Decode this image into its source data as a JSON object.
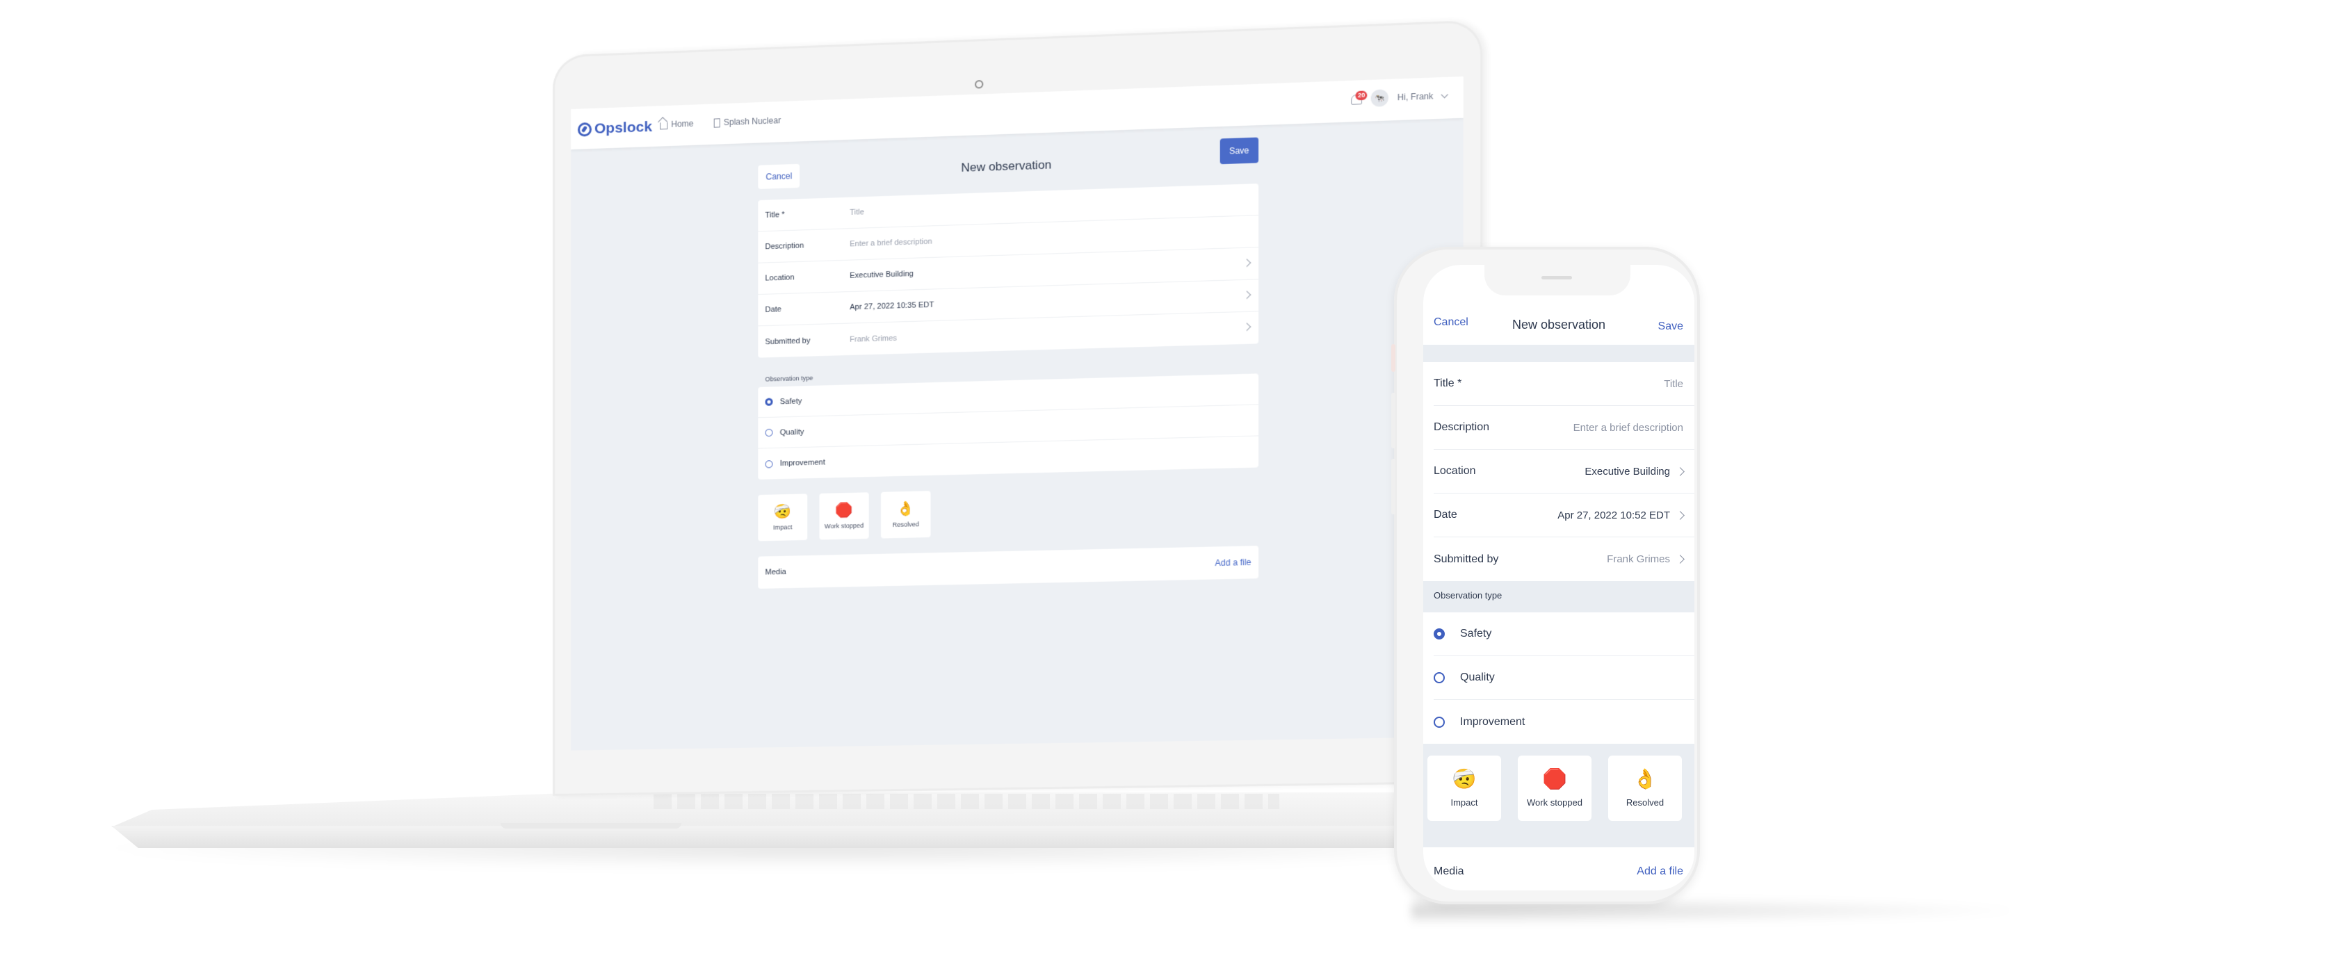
{
  "brand": {
    "name": "Opslock",
    "accent": "#3f5fbf",
    "button_color": "#4a6bc9",
    "badge_color": "#e5484d"
  },
  "laptop": {
    "topbar": {
      "nav": [
        {
          "label": "Home",
          "icon": "home-icon"
        },
        {
          "label": "Splash Nuclear",
          "icon": "building-icon"
        }
      ],
      "notifications_count": "20",
      "greeting": "Hi, Frank"
    },
    "form": {
      "cancel_label": "Cancel",
      "title": "New observation",
      "save_label": "Save",
      "fields": [
        {
          "label": "Title *",
          "value": "Title",
          "placeholder": true,
          "chevron": false
        },
        {
          "label": "Description",
          "value": "Enter a brief description",
          "placeholder": true,
          "chevron": false
        },
        {
          "label": "Location",
          "value": "Executive Building",
          "placeholder": false,
          "chevron": true
        },
        {
          "label": "Date",
          "value": "Apr 27, 2022 10:35 EDT",
          "placeholder": false,
          "chevron": true
        },
        {
          "label": "Submitted by",
          "value": "Frank Grimes",
          "placeholder": true,
          "chevron": true
        }
      ],
      "observation_type_label": "Observation type",
      "observation_types": [
        {
          "label": "Safety",
          "selected": true
        },
        {
          "label": "Quality",
          "selected": false
        },
        {
          "label": "Improvement",
          "selected": false
        }
      ],
      "tags": [
        {
          "emoji": "🤕",
          "label": "Impact"
        },
        {
          "emoji": "🛑",
          "label": "Work stopped"
        },
        {
          "emoji": "👌",
          "label": "Resolved"
        }
      ],
      "media_label": "Media",
      "add_file_label": "Add a file"
    }
  },
  "phone": {
    "cancel_label": "Cancel",
    "title": "New observation",
    "save_label": "Save",
    "fields": [
      {
        "label": "Title *",
        "value": "Title",
        "placeholder": true,
        "chevron": false
      },
      {
        "label": "Description",
        "value": "Enter a brief description",
        "placeholder": true,
        "chevron": false
      },
      {
        "label": "Location",
        "value": "Executive Building",
        "placeholder": false,
        "chevron": true
      },
      {
        "label": "Date",
        "value": "Apr 27, 2022 10:52 EDT",
        "placeholder": false,
        "chevron": true
      },
      {
        "label": "Submitted by",
        "value": "Frank Grimes",
        "placeholder": true,
        "chevron": true
      }
    ],
    "observation_type_label": "Observation type",
    "observation_types": [
      {
        "label": "Safety",
        "selected": true
      },
      {
        "label": "Quality",
        "selected": false
      },
      {
        "label": "Improvement",
        "selected": false
      }
    ],
    "tags": [
      {
        "emoji": "🤕",
        "label": "Impact"
      },
      {
        "emoji": "🛑",
        "label": "Work stopped"
      },
      {
        "emoji": "👌",
        "label": "Resolved"
      }
    ],
    "media_label": "Media",
    "add_file_label": "Add a file"
  }
}
